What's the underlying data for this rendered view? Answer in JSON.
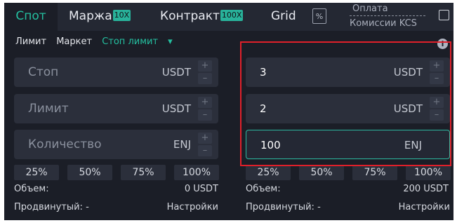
{
  "tabs": [
    {
      "label": "Спот",
      "badge": ""
    },
    {
      "label": "Маржа",
      "badge": "10X"
    },
    {
      "label": "Контракт",
      "badge": "100X"
    },
    {
      "label": "Grid",
      "badge": ""
    }
  ],
  "percent_icon": "percent-icon",
  "fee": {
    "line1": "Оплата",
    "line2": "Комиссии KCS"
  },
  "order_types": {
    "limit": "Лимит",
    "market": "Маркет",
    "stop_limit": "Стоп лимит"
  },
  "left": {
    "stop": {
      "label": "Стоп",
      "unit": "USDT"
    },
    "limit": {
      "label": "Лимит",
      "unit": "USDT"
    },
    "qty": {
      "label": "Количество",
      "unit": "ENJ"
    },
    "volume_label": "Объем:",
    "volume_value": "0 USDT",
    "advanced": "Продвинутый: -",
    "settings": "Настройки"
  },
  "right": {
    "stop": {
      "value": "3",
      "unit": "USDT"
    },
    "limit": {
      "value": "2",
      "unit": "USDT"
    },
    "qty": {
      "value": "100",
      "unit": "ENJ"
    },
    "volume_label": "Объем:",
    "volume_value": "200 USDT",
    "advanced": "Продвинутый: -",
    "settings": "Настройки"
  },
  "percents": [
    "25%",
    "50%",
    "75%",
    "100%"
  ],
  "stepper": {
    "plus": "+",
    "minus": "–"
  },
  "dropdown_glyph": "▾",
  "info_glyph": "i",
  "percent_glyph": "%",
  "colors": {
    "accent": "#24c0a0",
    "highlight": "#e0202a",
    "panel": "#1b1e27"
  }
}
